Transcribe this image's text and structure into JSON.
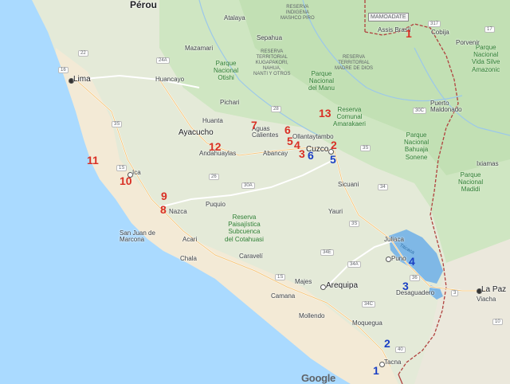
{
  "country": "Pérou",
  "cities": {
    "lima": "Lima",
    "huancayo": "Huancayo",
    "ayacucho": "Ayacucho",
    "andahuaylas": "Andahuaylas",
    "abancay": "Abancay",
    "cuzco": "Cuzco",
    "ollantaytambo": "Ollantaytambo",
    "aguas_calientes": "Aguas\nCalientes",
    "huanta": "Huanta",
    "pichari": "Pichari",
    "mazamari": "Mazamari",
    "atalaya": "Atalaya",
    "sepahua": "Sepahua",
    "assis_brasil": "Assis Brasil",
    "cobija": "Cobija",
    "porvenir": "Porvenir",
    "puerto_maldonado": "Puerto\nMaldonado",
    "ixiamas": "Ixiamas",
    "sicuani": "Sicuani",
    "yauri": "Yauri",
    "juliaca": "Juliaca",
    "puno": "Puno",
    "desaguadero": "Desaguadero",
    "la_paz": "La Paz",
    "viacha": "Viacha",
    "arequipa": "Arequipa",
    "majes": "Majes",
    "camana": "Camana",
    "mollendo": "Mollendo",
    "moquegua": "Moquegua",
    "tacna": "Tacna",
    "ica": "Ica",
    "nazca": "Nazca",
    "acari": "Acari",
    "chala": "Chala",
    "caraveli": "Caravelí",
    "puquio": "Puquio",
    "san_juan": "San Juan de\nMarcona"
  },
  "areas": {
    "otishi": "Parque\nNacional\nOtishi",
    "manu": "Parque\nNacional\ndel Manu",
    "mashco": "RESERVA\nINDIGENA\nMASHCO PIRO",
    "kugapakori": "RESERVA\nTERRITORIAL\nKUGAPAKORI,\nNAHUA,\nNANTI Y OTROS",
    "madre_dios": "RESERVA\nTERRITORIAL\nMADRE DE DIOS",
    "amarakaeri": "Reserva\nComunal\nAmarakaeri",
    "bahuaja": "Parque\nNacional\nBahuaja\nSonene",
    "madidi": "Parque\nNacional\nMadidi",
    "amazonic": "Parque\nNacional\nVida Silve\nAmazonic",
    "cotahuasi": "Reserva\nPaisajística\nSubcuenca\ndel Cotahuasi",
    "mamoadate": "MAMOADATE",
    "lake": "Titicaca"
  },
  "roads": [
    "317",
    "22",
    "24A",
    "3S",
    "26",
    "28",
    "3S",
    "30C",
    "3S",
    "1S",
    "30A",
    "34",
    "34E",
    "34A",
    "36",
    "40",
    "1S",
    "34C",
    "16",
    "17",
    "10",
    "3"
  ],
  "markers": {
    "red": [
      "1",
      "2",
      "3",
      "4",
      "5",
      "6",
      "7",
      "8",
      "9",
      "10",
      "11",
      "12",
      "13"
    ],
    "blue": [
      "1",
      "2",
      "3",
      "4",
      "5",
      "6"
    ]
  },
  "attribution": "Google",
  "colors": {
    "sea": "#aadaff",
    "coast_desert": "#f5ecd9",
    "highland": "#e7ebdc",
    "jungle": "#c4e3b8",
    "lake": "#7fb8e6",
    "marker_red": "#d93025",
    "marker_blue": "#1a3fc4",
    "border": "#b0413e"
  }
}
